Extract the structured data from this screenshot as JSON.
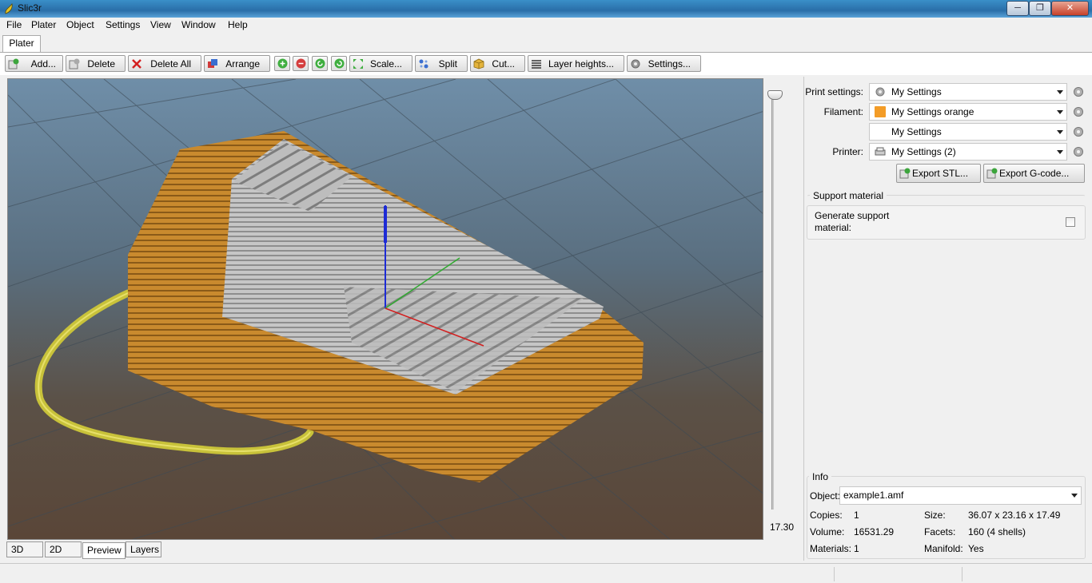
{
  "window": {
    "title": "Slic3r",
    "minimize_label": "─",
    "maximize_label": "❐",
    "close_label": "✕"
  },
  "menu": [
    "File",
    "Plater",
    "Object",
    "Settings",
    "View",
    "Window",
    "Help"
  ],
  "tabs": {
    "plater": "Plater"
  },
  "toolbar": {
    "add": "Add...",
    "delete": "Delete",
    "delete_all": "Delete All",
    "arrange": "Arrange",
    "scale": "Scale...",
    "split": "Split",
    "cut": "Cut...",
    "layer_heights": "Layer heights...",
    "settings": "Settings..."
  },
  "slider": {
    "value": "17.30"
  },
  "view_tabs": [
    "3D",
    "2D",
    "Preview",
    "Layers"
  ],
  "active_view_tab": "Preview",
  "settings_panel": {
    "print_label": "Print settings:",
    "print_value": "My Settings",
    "filament_label": "Filament:",
    "filament_value": "My Settings orange",
    "filament_color": "#f39c27",
    "filament2_value": "My Settings",
    "printer_label": "Printer:",
    "printer_value": "My Settings (2)",
    "export_stl": "Export STL...",
    "export_gcode": "Export G-code..."
  },
  "support": {
    "title": "Support material",
    "generate_label_line1": "Generate support",
    "generate_label_line2": "material:",
    "checked": false
  },
  "info": {
    "title": "Info",
    "object_label": "Object:",
    "object_value": "example1.amf",
    "copies_label": "Copies:",
    "copies_value": "1",
    "size_label": "Size:",
    "size_value": "36.07 x 23.16 x 17.49",
    "volume_label": "Volume:",
    "volume_value": "16531.29",
    "facets_label": "Facets:",
    "facets_value": "160 (4 shells)",
    "materials_label": "Materials:",
    "materials_value": "1",
    "manifold_label": "Manifold:",
    "manifold_value": "Yes"
  },
  "colors": {
    "model_orange": "#c98a2e",
    "model_gray": "#bdbdbd",
    "skirt_yellow": "#c8c23a",
    "axis_x": "#d21e1e",
    "axis_y": "#2faa2f",
    "axis_z": "#1d2bd6"
  }
}
